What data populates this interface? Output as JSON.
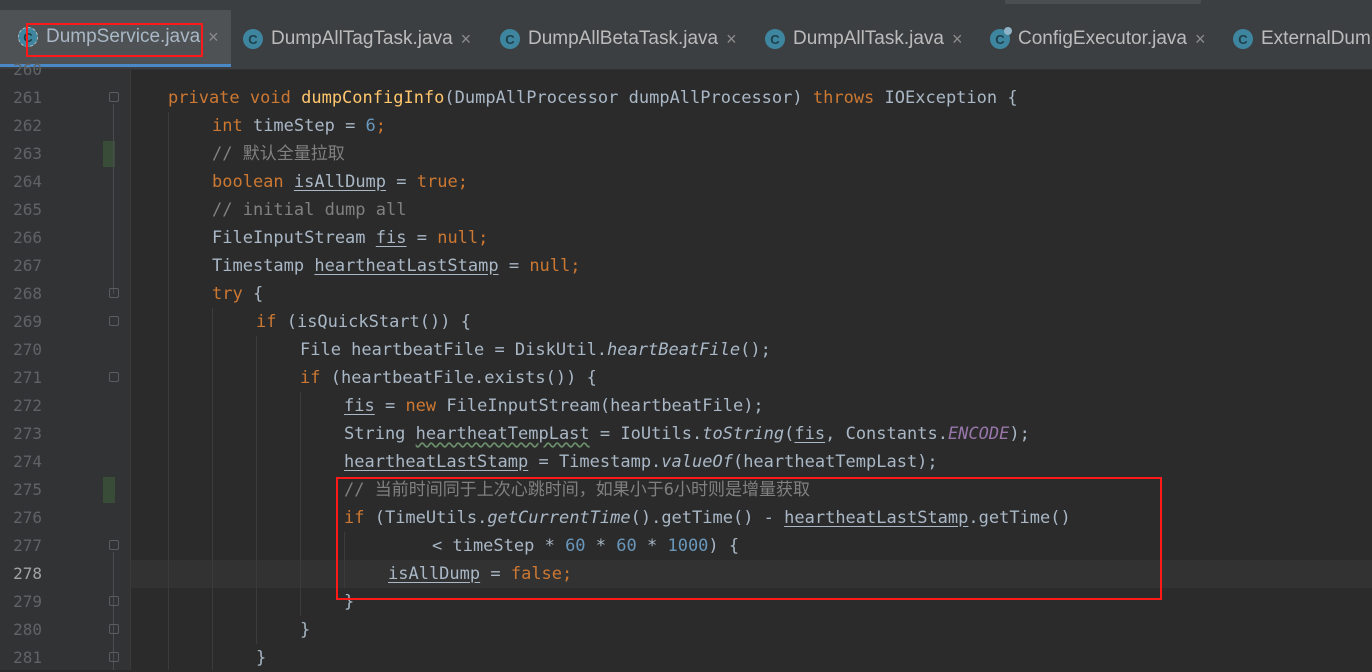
{
  "tabs": [
    {
      "label": "DumpService.java",
      "close": "×",
      "active": true
    },
    {
      "label": "DumpAllTagTask.java",
      "close": "×"
    },
    {
      "label": "DumpAllBetaTask.java",
      "close": "×"
    },
    {
      "label": "DumpAllTask.java",
      "close": "×"
    },
    {
      "label": "ConfigExecutor.java",
      "close": "×"
    },
    {
      "label": "ExternalDum"
    }
  ],
  "icons": {
    "class_icon_letter": "C"
  },
  "colors": {
    "highlight_box": "#ff1a1a",
    "editor_bg": "#2b2b2b",
    "keyword": "#cc7832",
    "method_decl": "#ffc66d",
    "number": "#6897bb",
    "comment": "#808080",
    "constant": "#9876aa"
  },
  "editor": {
    "partial_line": "260",
    "current_line": "278",
    "lines": [
      {
        "num": "261",
        "t": [
          "private",
          " ",
          "void",
          " ",
          "dumpConfigInfo",
          "(DumpAllProcessor dumpAllProcessor) ",
          "throws",
          " IOException {"
        ]
      },
      {
        "num": "262",
        "t": [
          "int",
          " timeStep = ",
          "6",
          ";"
        ]
      },
      {
        "num": "263",
        "t": [
          "// 默认全量拉取"
        ]
      },
      {
        "num": "264",
        "t": [
          "boolean",
          " ",
          "isAllDump",
          " = ",
          "true",
          ";"
        ]
      },
      {
        "num": "265",
        "t": [
          "// initial dump all"
        ]
      },
      {
        "num": "266",
        "t": [
          "FileInputStream ",
          "fis",
          " = ",
          "null",
          ";"
        ]
      },
      {
        "num": "267",
        "t": [
          "Timestamp ",
          "heartheatLastStamp",
          " = ",
          "null",
          ";"
        ]
      },
      {
        "num": "268",
        "t": [
          "try",
          " {"
        ]
      },
      {
        "num": "269",
        "t": [
          "if",
          " (isQuickStart()) {"
        ]
      },
      {
        "num": "270",
        "t": [
          "File heartbeatFile = DiskUtil.",
          "heartBeatFile",
          "();"
        ]
      },
      {
        "num": "271",
        "t": [
          "if",
          " (heartbeatFile.exists()) {"
        ]
      },
      {
        "num": "272",
        "t": [
          "fis",
          " = ",
          "new",
          " FileInputStream(heartbeatFile);"
        ]
      },
      {
        "num": "273",
        "t": [
          "String ",
          "heartheatTempLast",
          " = IoUtils.",
          "toString",
          "(",
          "fis",
          ", Constants.",
          "ENCODE",
          ");"
        ]
      },
      {
        "num": "274",
        "t": [
          "heartheatLastStamp",
          " = Timestamp.",
          "valueOf",
          "(heartheatTempLast);"
        ]
      },
      {
        "num": "275",
        "t": [
          "// 当前时间同于上次心跳时间，如果小于6小时则是增量获取"
        ]
      },
      {
        "num": "276",
        "t": [
          "if",
          " (TimeUtils.",
          "getCurrentTime",
          "().getTime() - ",
          "heartheatLastStamp",
          ".getTime()"
        ]
      },
      {
        "num": "277",
        "t": [
          "< timeStep * ",
          "60",
          " * ",
          "60",
          " * ",
          "1000",
          ") {"
        ]
      },
      {
        "num": "278",
        "t": [
          "isAllDump",
          " = ",
          "false",
          ";"
        ]
      },
      {
        "num": "279",
        "t": [
          "}"
        ]
      },
      {
        "num": "280",
        "t": [
          "}"
        ]
      },
      {
        "num": "281",
        "t": [
          "}"
        ]
      }
    ]
  }
}
